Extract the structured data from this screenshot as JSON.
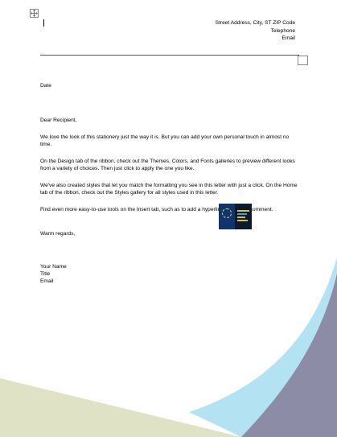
{
  "sender": {
    "address": "Street Address, City, ST ZIP Code",
    "telephone": "Telephone",
    "email": "Email"
  },
  "letter": {
    "date": "Date",
    "salutation": "Dear Recipient,",
    "para1": "We love the look of this stationery just the way it is. But you can add your own personal touch in almost no time.",
    "para2": "On the Design tab of the ribbon, check out the Themes, Colors, and Fonts galleries to preview different looks from a variety of choices. Then just click to apply the one you like.",
    "para3": "We've also created styles that let you match the formatting you see in this letter with just a click. On the Home tab of the ribbon, check out the Styles gallery for all styles used in this letter.",
    "para4": "Find even more easy-to-use tools on the Insert tab, such as to add a hyperlink or insert a comment.",
    "closing": "Warm regards,",
    "signature": {
      "name": "Your Name",
      "title": "Title",
      "email": "Email"
    }
  },
  "colors": {
    "light_blue": "#b3e3f3",
    "slate": "#8c8ca6",
    "sage": "#dfe2c4",
    "rule": "#555555"
  },
  "icons": {
    "move_handle": "move-handle-icon",
    "inserted_image": "inserted-image-thumbnail"
  }
}
